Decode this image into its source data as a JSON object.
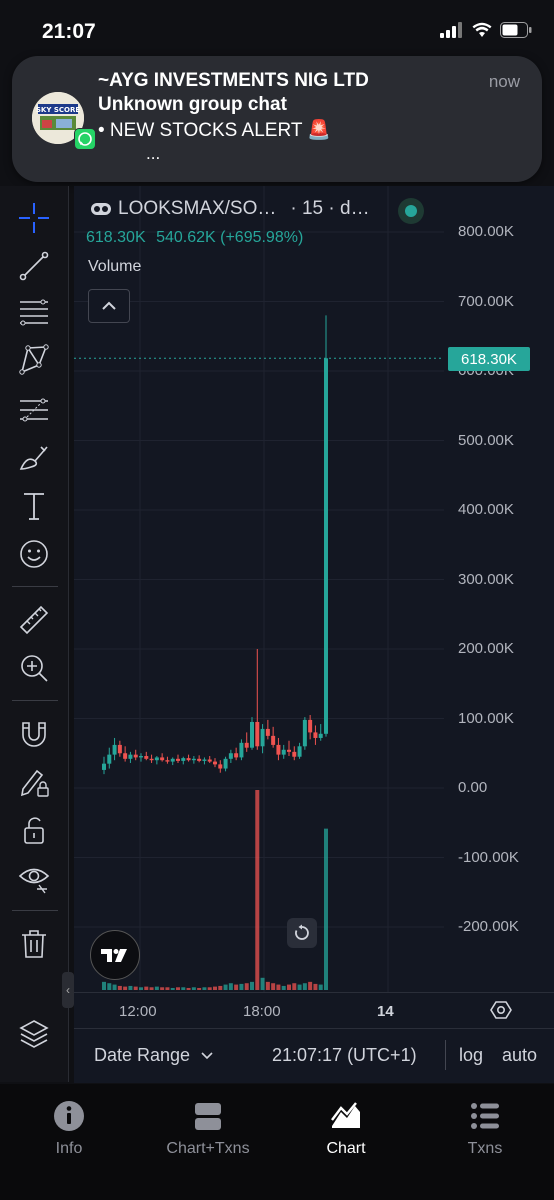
{
  "status_bar": {
    "time": "21:07"
  },
  "notification": {
    "title": "~AYG INVESTMENTS NIG LTD",
    "subtitle": "Unknown group chat",
    "body": "•  NEW STOCKS ALERT 🚨",
    "more": "...",
    "time": "now",
    "avatar_text": "SKY SCORE"
  },
  "chart_header": {
    "symbol": "LOOKSMAX/SO…",
    "interval": "· 15 · d…",
    "last_value": "618.30K",
    "change": "540.62K (+695.98%)",
    "volume_label": "Volume"
  },
  "price_label": "618.30K",
  "chart_data": {
    "type": "candlestick",
    "y_ticks": [
      "800.00K",
      "700.00K",
      "600.00K",
      "500.00K",
      "400.00K",
      "300.00K",
      "200.00K",
      "100.00K",
      "0.00",
      "-100.00K",
      "-200.00K"
    ],
    "x_ticks": [
      "12:00",
      "18:00",
      "14"
    ],
    "ylim": [
      -290000,
      820000
    ],
    "current_price": 618300,
    "candles": [
      [
        26000,
        45000,
        20000,
        35000
      ],
      [
        35000,
        58000,
        28000,
        48000
      ],
      [
        48000,
        72000,
        40000,
        62000
      ],
      [
        62000,
        68000,
        45000,
        50000
      ],
      [
        50000,
        60000,
        38000,
        42000
      ],
      [
        42000,
        52000,
        36000,
        48000
      ],
      [
        48000,
        55000,
        40000,
        44000
      ],
      [
        44000,
        50000,
        38000,
        46000
      ],
      [
        46000,
        52000,
        40000,
        42000
      ],
      [
        42000,
        48000,
        36000,
        40000
      ],
      [
        40000,
        46000,
        34000,
        44000
      ],
      [
        44000,
        50000,
        38000,
        40000
      ],
      [
        40000,
        45000,
        35000,
        38000
      ],
      [
        38000,
        44000,
        33000,
        42000
      ],
      [
        42000,
        48000,
        36000,
        39000
      ],
      [
        39000,
        45000,
        34000,
        43000
      ],
      [
        43000,
        48000,
        38000,
        40000
      ],
      [
        40000,
        46000,
        35000,
        42000
      ],
      [
        42000,
        47000,
        37000,
        39000
      ],
      [
        39000,
        44000,
        34000,
        41000
      ],
      [
        41000,
        46000,
        36000,
        38000
      ],
      [
        38000,
        43000,
        30000,
        34000
      ],
      [
        34000,
        40000,
        22000,
        28000
      ],
      [
        28000,
        45000,
        24000,
        42000
      ],
      [
        42000,
        55000,
        36000,
        50000
      ],
      [
        50000,
        58000,
        40000,
        44000
      ],
      [
        44000,
        70000,
        40000,
        65000
      ],
      [
        65000,
        80000,
        52000,
        58000
      ],
      [
        58000,
        102000,
        55000,
        95000
      ],
      [
        95000,
        200000,
        55000,
        60000
      ],
      [
        60000,
        92000,
        50000,
        85000
      ],
      [
        85000,
        98000,
        70000,
        75000
      ],
      [
        75000,
        88000,
        58000,
        62000
      ],
      [
        62000,
        72000,
        40000,
        48000
      ],
      [
        48000,
        62000,
        42000,
        55000
      ],
      [
        55000,
        68000,
        46000,
        52000
      ],
      [
        52000,
        60000,
        40000,
        45000
      ],
      [
        45000,
        65000,
        42000,
        60000
      ],
      [
        60000,
        102000,
        55000,
        98000
      ],
      [
        98000,
        105000,
        70000,
        80000
      ],
      [
        80000,
        90000,
        62000,
        72000
      ],
      [
        72000,
        92000,
        68000,
        78000
      ],
      [
        78000,
        680000,
        74000,
        618300
      ]
    ],
    "volume": [
      12,
      10,
      8,
      6,
      5,
      6,
      5,
      4,
      5,
      4,
      5,
      4,
      4,
      3,
      4,
      4,
      3,
      4,
      3,
      4,
      4,
      5,
      6,
      8,
      10,
      8,
      9,
      10,
      12,
      295,
      18,
      12,
      10,
      8,
      6,
      8,
      10,
      8,
      10,
      12,
      9,
      8,
      238
    ]
  },
  "time_axis": {
    "settings": "gear"
  },
  "bottom_bar": {
    "date_range": "Date Range",
    "clock": "21:07:17 (UTC+1)",
    "log": "log",
    "auto": "auto"
  },
  "tabs": [
    {
      "label": "Info",
      "icon": "info-icon"
    },
    {
      "label": "Chart+Txns",
      "icon": "split-view-icon"
    },
    {
      "label": "Chart",
      "icon": "chart-icon",
      "active": true
    },
    {
      "label": "Txns",
      "icon": "list-icon"
    }
  ],
  "colors": {
    "up": "#26a69a",
    "down": "#ef5350",
    "background": "#131722",
    "accent_blue": "#2962ff"
  }
}
